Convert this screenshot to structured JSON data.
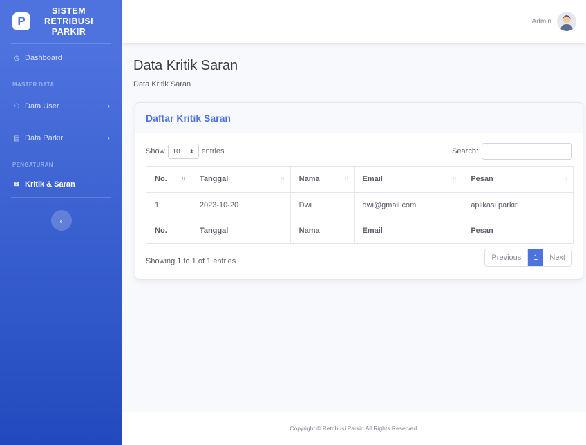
{
  "brand": {
    "logo_letter": "P",
    "line1": "SISTEM",
    "line2": "RETRIBUSI",
    "line3": "PARKIR"
  },
  "sidebar": {
    "dashboard": {
      "label": "Dashboard",
      "icon": "dashboard-icon"
    },
    "heading_master": "MASTER DATA",
    "data_user": {
      "label": "Data User",
      "icon": "users-icon"
    },
    "data_parkir": {
      "label": "Data Parkir",
      "icon": "table-icon"
    },
    "heading_settings": "PENGATURAN",
    "kritik_saran": {
      "label": "Kritik & Saran",
      "icon": "envelope-icon"
    },
    "toggle_icon": "‹"
  },
  "topbar": {
    "user_name": "Admin"
  },
  "page": {
    "title": "Data Kritik Saran",
    "breadcrumb": "Data Kritik Saran"
  },
  "card": {
    "title": "Daftar Kritik Saran",
    "show_label": "Show",
    "entries_value": "10",
    "entries_label": "entries",
    "search_label": "Search:",
    "columns": [
      "No.",
      "Tanggal",
      "Nama",
      "Email",
      "Pesan"
    ],
    "rows": [
      {
        "no": "1",
        "tanggal": "2023-10-20",
        "nama": "Dwi",
        "email": "dwi@gmail.com",
        "pesan": "aplikasi parkir"
      }
    ],
    "info": "Showing 1 to 1 of 1 entries",
    "pagination": {
      "previous": "Previous",
      "current": "1",
      "next": "Next"
    }
  },
  "footer": {
    "text": "Copyright © Retribusi Parkir. All Rights Reserved."
  },
  "colors": {
    "primary": "#4e73df",
    "primary_dark": "#224abe"
  }
}
